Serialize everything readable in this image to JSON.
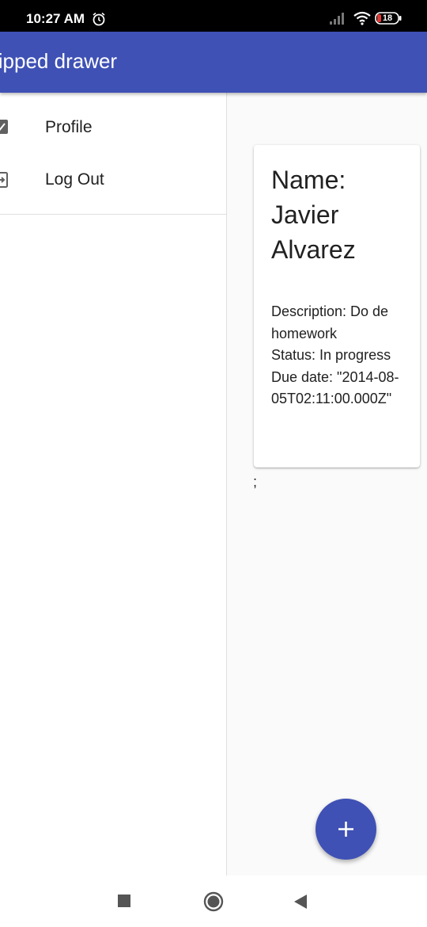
{
  "status_bar": {
    "time": "10:27 AM",
    "battery": "18",
    "icons": [
      "alarm-icon",
      "signal-icon",
      "wifi-icon",
      "battery-icon"
    ]
  },
  "app_bar": {
    "title": "lipped drawer",
    "color": "#3f51b5"
  },
  "drawer": {
    "items": [
      {
        "label": "Profile",
        "icon": "profile-icon"
      },
      {
        "label": "Log Out",
        "icon": "logout-icon"
      }
    ]
  },
  "card": {
    "title": "Name: Javier Alvarez",
    "description": "Description: Do de homework",
    "status": "Status: In progress",
    "due_date": "Due date: \"2014-08-05T02:11:00.000Z\""
  },
  "trailing_text": ";",
  "fab": {
    "icon": "plus-icon",
    "color": "#3f51b5"
  },
  "nav_bar": {
    "icons": [
      "recents-icon",
      "home-icon",
      "back-icon"
    ]
  }
}
